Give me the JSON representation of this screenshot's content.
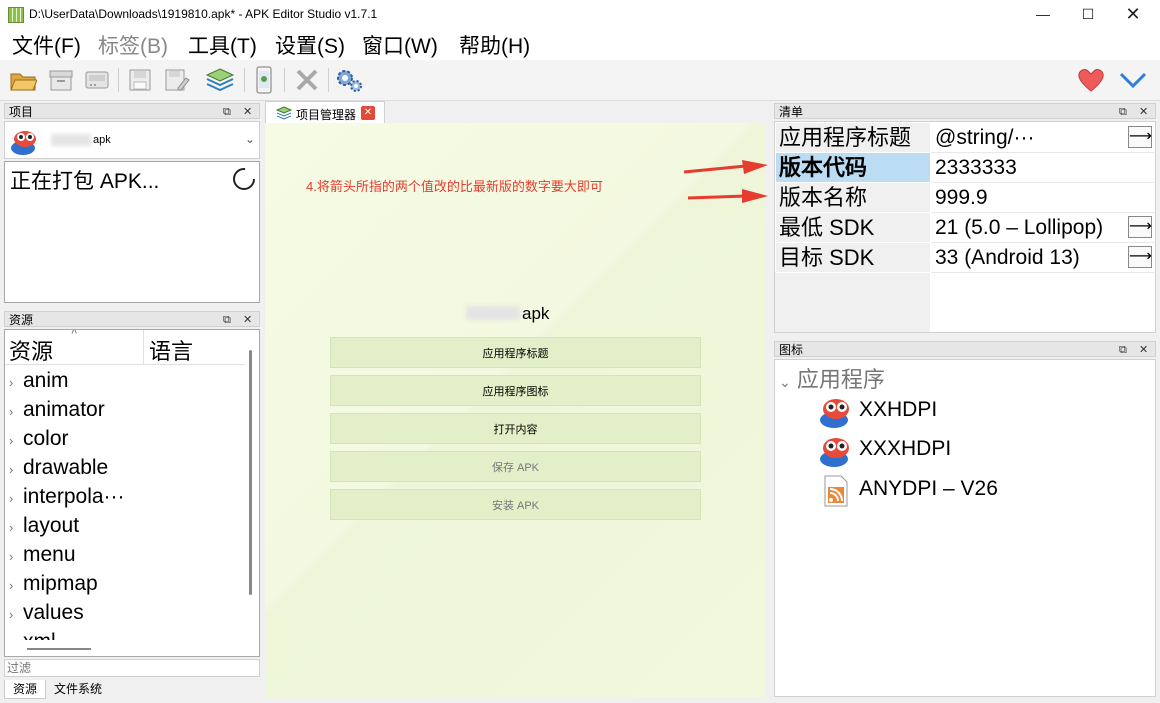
{
  "window": {
    "title": "D:\\UserData\\Downloads\\1919810.apk* - APK Editor Studio v1.7.1"
  },
  "menu": [
    "文件(F)",
    "标签(B)",
    "工具(T)",
    "设置(S)",
    "窗口(W)",
    "帮助(H)"
  ],
  "project_panel": {
    "title": "项目",
    "selected_project": "apk",
    "status": "正在打包 APK..."
  },
  "resources_panel": {
    "title": "资源",
    "col_resource": "资源",
    "col_language": "语言",
    "items": [
      "anim",
      "animator",
      "color",
      "drawable",
      "interpola···",
      "layout",
      "menu",
      "mipmap",
      "values",
      "xml"
    ],
    "filter_placeholder": "过滤",
    "tabs": [
      "资源",
      "文件系统"
    ]
  },
  "center": {
    "tab_label": "项目管理器",
    "annotation": "4.将箭头所指的两个值改的比最新版的数字要大即可",
    "apk_name": "apk",
    "buttons": [
      "应用程序标题",
      "应用程序图标",
      "打开内容",
      "保存 APK",
      "安装 APK"
    ]
  },
  "manifest_panel": {
    "title": "清单",
    "rows": [
      {
        "key": "应用程序标题",
        "value": "@string/···"
      },
      {
        "key": "版本代码",
        "value": "2333333"
      },
      {
        "key": "版本名称",
        "value": "999.9"
      },
      {
        "key": "最低 SDK",
        "value": "21 (5.0 – Lollipop)"
      },
      {
        "key": "目标 SDK",
        "value": "33 (Android 13)"
      }
    ]
  },
  "icons_panel": {
    "title": "图标",
    "group": "应用程序",
    "items": [
      "XXHDPI",
      "XXXHDPI",
      "ANYDPI – V26"
    ]
  },
  "colors": {
    "accent_red": "#e63b2e",
    "selection_blue": "#bcdcf4",
    "heart": "#ef5b5b"
  }
}
